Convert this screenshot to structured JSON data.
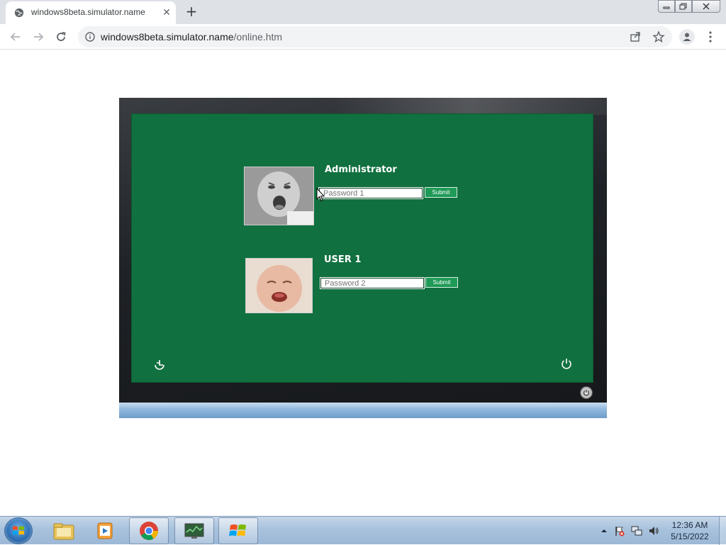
{
  "browser": {
    "tab_title": "windows8beta.simulator.name",
    "url_host": "windows8beta.simulator.name",
    "url_path": "/online.htm"
  },
  "users": [
    {
      "name": "Administrator",
      "password_placeholder": "Password 1",
      "submit_label": "Submit"
    },
    {
      "name": "USER 1",
      "password_placeholder": "Password 2",
      "submit_label": "Submit"
    }
  ],
  "screen": {
    "background_color": "#11703f"
  },
  "taskbar": {
    "clock_time": "12:36 AM",
    "clock_date": "5/15/2022",
    "items": [
      "file-explorer-icon",
      "media-player-icon",
      "chrome-icon",
      "system-monitor-icon",
      "windows-flag-icon"
    ]
  }
}
